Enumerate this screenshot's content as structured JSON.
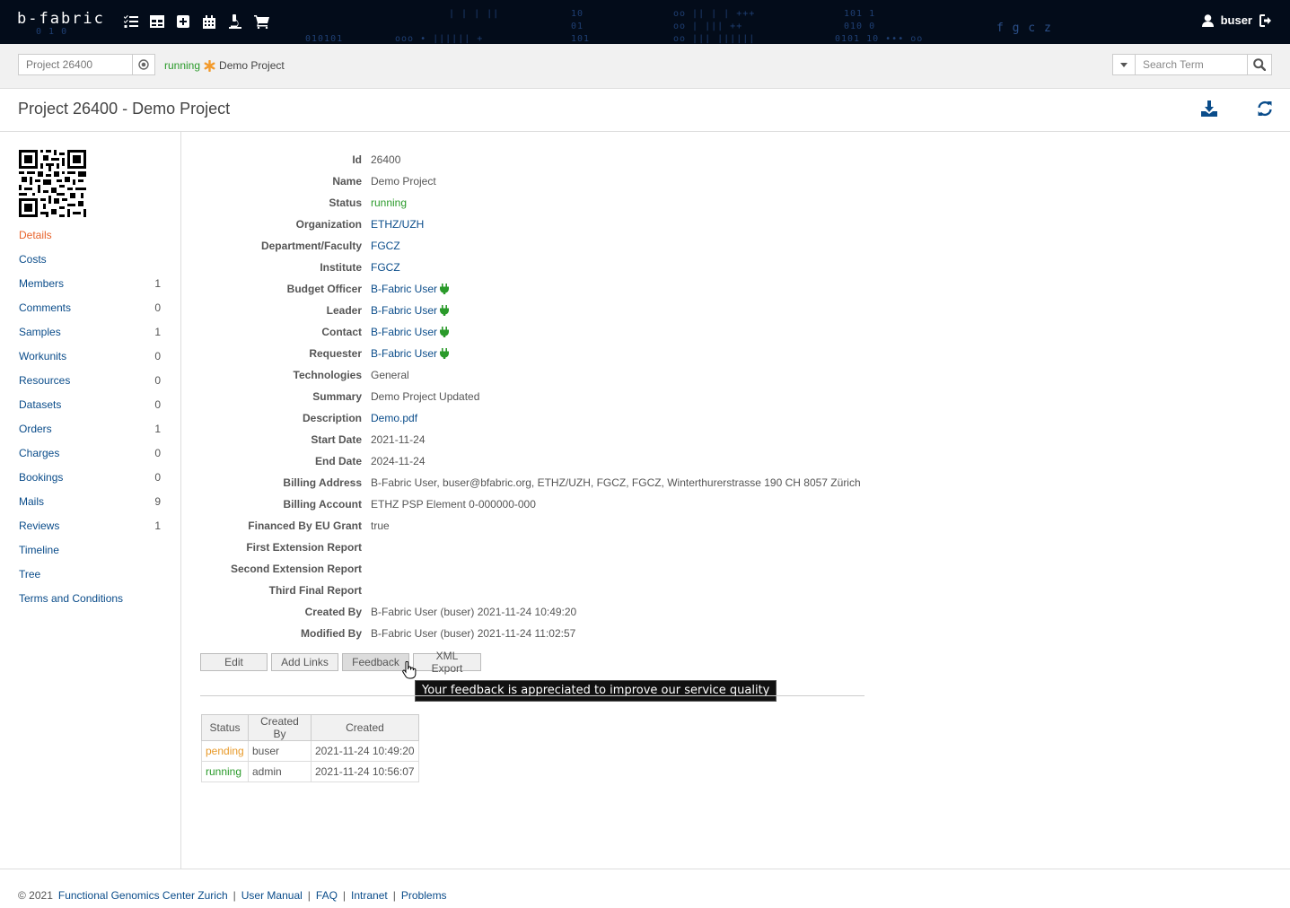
{
  "header": {
    "logo": "b-fabric",
    "nav_icons": [
      "tasks-icon",
      "table-icon",
      "plus-square-icon",
      "calendar-icon",
      "microscope-icon",
      "cart-icon"
    ],
    "username": "buser"
  },
  "subbar": {
    "project_value": "Project 26400",
    "status": "running",
    "project_name": "Demo Project",
    "search_placeholder": "Search Term"
  },
  "page": {
    "title": "Project 26400 - Demo Project"
  },
  "sidebar": {
    "items": [
      {
        "label": "Details",
        "count": ""
      },
      {
        "label": "Costs",
        "count": ""
      },
      {
        "label": "Members",
        "count": "1"
      },
      {
        "label": "Comments",
        "count": "0"
      },
      {
        "label": "Samples",
        "count": "1"
      },
      {
        "label": "Workunits",
        "count": "0"
      },
      {
        "label": "Resources",
        "count": "0"
      },
      {
        "label": "Datasets",
        "count": "0"
      },
      {
        "label": "Orders",
        "count": "1"
      },
      {
        "label": "Charges",
        "count": "0"
      },
      {
        "label": "Bookings",
        "count": "0"
      },
      {
        "label": "Mails",
        "count": "9"
      },
      {
        "label": "Reviews",
        "count": "1"
      },
      {
        "label": "Timeline",
        "count": ""
      },
      {
        "label": "Tree",
        "count": ""
      },
      {
        "label": "Terms and Conditions",
        "count": ""
      }
    ]
  },
  "details": {
    "fields": [
      {
        "label": "Id",
        "value": "26400"
      },
      {
        "label": "Name",
        "value": "Demo Project"
      },
      {
        "label": "Status",
        "value": "running"
      },
      {
        "label": "Organization",
        "value": "ETHZ/UZH"
      },
      {
        "label": "Department/Faculty",
        "value": "FGCZ"
      },
      {
        "label": "Institute",
        "value": "FGCZ"
      },
      {
        "label": "Budget Officer",
        "value": "B-Fabric User"
      },
      {
        "label": "Leader",
        "value": "B-Fabric User"
      },
      {
        "label": "Contact",
        "value": "B-Fabric User"
      },
      {
        "label": "Requester",
        "value": "B-Fabric User"
      },
      {
        "label": "Technologies",
        "value": "General"
      },
      {
        "label": "Summary",
        "value": "Demo Project Updated"
      },
      {
        "label": "Description",
        "value": "Demo.pdf"
      },
      {
        "label": "Start Date",
        "value": "2021-11-24"
      },
      {
        "label": "End Date",
        "value": "2024-11-24"
      },
      {
        "label": "Billing Address",
        "value": "B-Fabric User, buser@bfabric.org, ETHZ/UZH, FGCZ, FGCZ, Winterthurerstrasse 190 CH 8057 Zürich"
      },
      {
        "label": "Billing Account",
        "value": "ETHZ PSP Element 0-000000-000"
      },
      {
        "label": "Financed By EU Grant",
        "value": "true"
      },
      {
        "label": "First Extension Report",
        "value": ""
      },
      {
        "label": "Second Extension Report",
        "value": ""
      },
      {
        "label": "Third Final Report",
        "value": ""
      },
      {
        "label": "Created By",
        "value": "B-Fabric User (buser) 2021-11-24 10:49:20"
      },
      {
        "label": "Modified By",
        "value": "B-Fabric User (buser) 2021-11-24 11:02:57"
      }
    ]
  },
  "actions": {
    "edit": "Edit",
    "add_links": "Add Links",
    "feedback": "Feedback",
    "xml_export": "XML Export",
    "tooltip": "Your feedback is appreciated to improve our service quality"
  },
  "history": {
    "headers": [
      "Status",
      "Created By",
      "Created"
    ],
    "rows": [
      [
        "pending",
        "buser",
        "2021-11-24 10:49:20"
      ],
      [
        "running",
        "admin",
        "2021-11-24 10:56:07"
      ]
    ]
  },
  "footer": {
    "copyright": "© 2021",
    "org": "Functional Genomics Center Zurich",
    "links": [
      "User Manual",
      "FAQ",
      "Intranet",
      "Problems"
    ],
    "separator": "|"
  },
  "colors": {
    "topbar": "#030c1a",
    "link": "#0a4c8a",
    "active": "#e8632b",
    "running": "#2a9a2a",
    "pending": "#e89a2a"
  }
}
